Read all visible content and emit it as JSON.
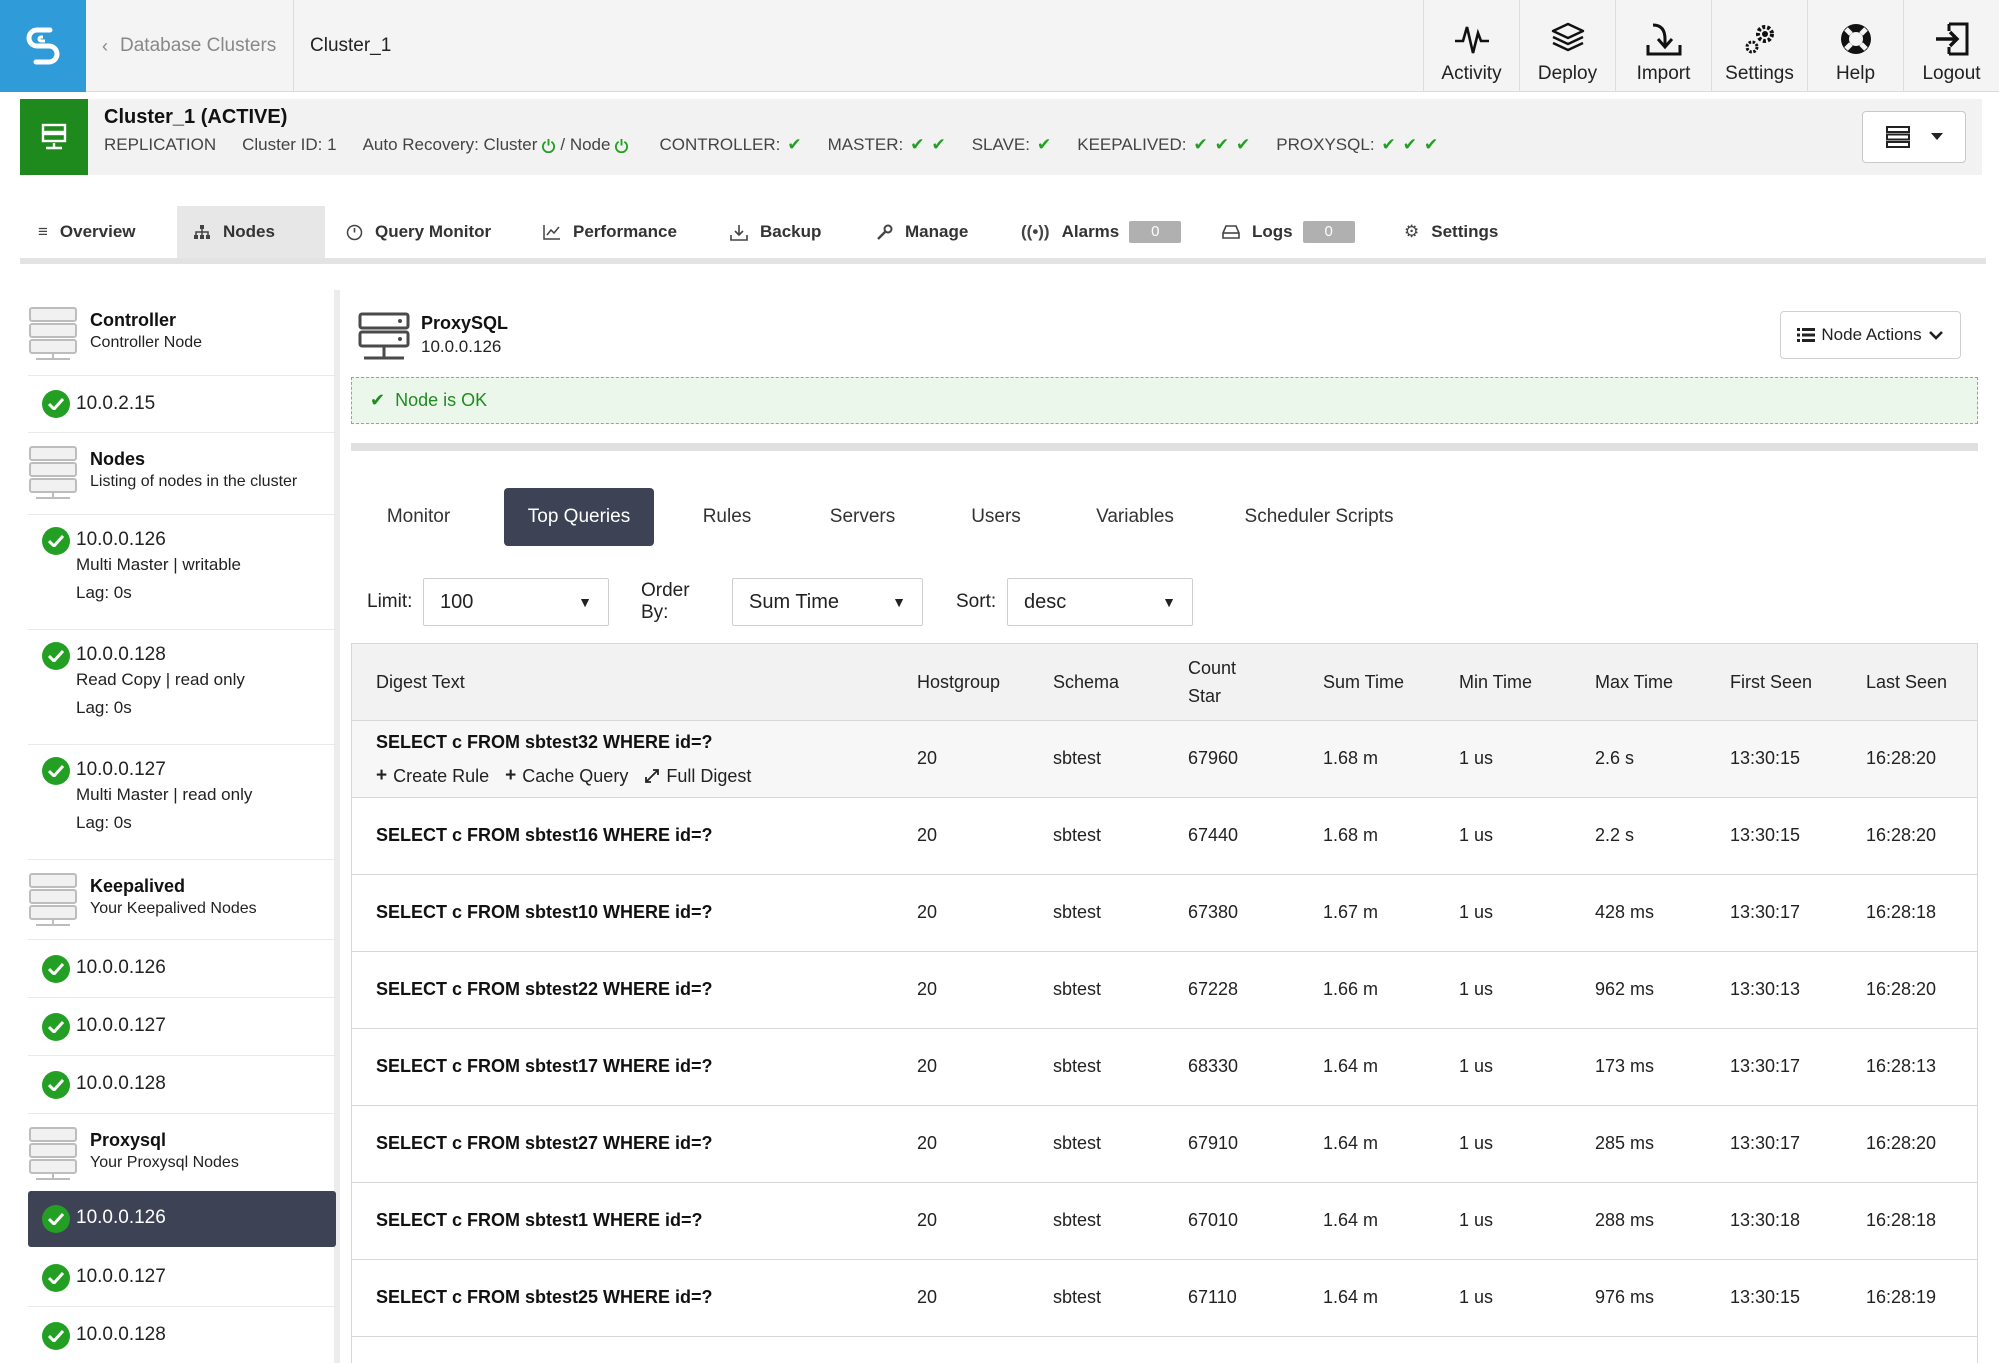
{
  "breadcrumb": {
    "back_label": "Database Clusters",
    "current": "Cluster_1"
  },
  "top_nav": [
    {
      "label": "Activity",
      "icon": "activity-icon"
    },
    {
      "label": "Deploy",
      "icon": "deploy-icon"
    },
    {
      "label": "Import",
      "icon": "import-icon"
    },
    {
      "label": "Settings",
      "icon": "settings-gears-icon"
    },
    {
      "label": "Help",
      "icon": "help-lifebuoy-icon"
    },
    {
      "label": "Logout",
      "icon": "logout-icon"
    }
  ],
  "cluster": {
    "title": "Cluster_1 (ACTIVE)",
    "type": "REPLICATION",
    "cluster_id": "Cluster ID: 1",
    "auto_recovery": "Auto Recovery: Cluster",
    "auto_recovery_node": "/ Node",
    "roles": [
      {
        "label": "CONTROLLER:",
        "checks": 1
      },
      {
        "label": "MASTER:",
        "checks": 2
      },
      {
        "label": "SLAVE:",
        "checks": 1
      },
      {
        "label": "KEEPALIVED:",
        "checks": 3
      },
      {
        "label": "PROXYSQL:",
        "checks": 3
      }
    ],
    "check_glyph": "✔"
  },
  "tabs": {
    "overview": "Overview",
    "nodes": "Nodes",
    "query_monitor": "Query Monitor",
    "performance": "Performance",
    "backup": "Backup",
    "manage": "Manage",
    "alarms": "Alarms",
    "alarms_count": "0",
    "logs": "Logs",
    "logs_count": "0",
    "settings": "Settings"
  },
  "sidebar": {
    "groups": [
      {
        "title": "Controller",
        "subtitle": "Controller Node"
      },
      {
        "title": "Nodes",
        "subtitle": "Listing of nodes in the cluster"
      },
      {
        "title": "Keepalived",
        "subtitle": "Your Keepalived Nodes"
      },
      {
        "title": "Proxysql",
        "subtitle": "Your Proxysql Nodes"
      }
    ],
    "controller_ip": "10.0.2.15",
    "db_nodes": [
      {
        "ip": "10.0.0.126",
        "role": "Multi Master | writable",
        "lag": "Lag: 0s"
      },
      {
        "ip": "10.0.0.128",
        "role": "Read Copy | read only",
        "lag": "Lag: 0s"
      },
      {
        "ip": "10.0.0.127",
        "role": "Multi Master | read only",
        "lag": "Lag: 0s"
      }
    ],
    "keepalived_ips": [
      "10.0.0.126",
      "10.0.0.127",
      "10.0.0.128"
    ],
    "proxysql_ips": [
      "10.0.0.126",
      "10.0.0.127",
      "10.0.0.128"
    ]
  },
  "node": {
    "title": "ProxySQL",
    "ip": "10.0.0.126",
    "actions_label": "Node Actions",
    "status": "Node is OK"
  },
  "subtabs": [
    "Monitor",
    "Top Queries",
    "Rules",
    "Servers",
    "Users",
    "Variables",
    "Scheduler Scripts"
  ],
  "filters": {
    "limit_label": "Limit:",
    "limit_value": "100",
    "order_label": "Order By:",
    "order_value": "Sum Time",
    "sort_label": "Sort:",
    "sort_value": "desc"
  },
  "table": {
    "headers": {
      "digest": "Digest Text",
      "hostgroup": "Hostgroup",
      "schema": "Schema",
      "count_star_1": "Count",
      "count_star_2": "Star",
      "sum_time": "Sum Time",
      "min_time": "Min Time",
      "max_time": "Max Time",
      "first_seen": "First Seen",
      "last_seen": "Last Seen"
    },
    "row_actions": {
      "create_rule": "Create Rule",
      "cache_query": "Cache Query",
      "full_digest": "Full Digest"
    },
    "rows": [
      {
        "digest": "SELECT c FROM sbtest32 WHERE id=?",
        "hostgroup": "20",
        "schema": "sbtest",
        "count_star": "67960",
        "sum_time": "1.68 m",
        "min_time": "1 us",
        "max_time": "2.6 s",
        "first_seen": "13:30:15",
        "last_seen": "16:28:20"
      },
      {
        "digest": "SELECT c FROM sbtest16 WHERE id=?",
        "hostgroup": "20",
        "schema": "sbtest",
        "count_star": "67440",
        "sum_time": "1.68 m",
        "min_time": "1 us",
        "max_time": "2.2 s",
        "first_seen": "13:30:15",
        "last_seen": "16:28:20"
      },
      {
        "digest": "SELECT c FROM sbtest10 WHERE id=?",
        "hostgroup": "20",
        "schema": "sbtest",
        "count_star": "67380",
        "sum_time": "1.67 m",
        "min_time": "1 us",
        "max_time": "428 ms",
        "first_seen": "13:30:17",
        "last_seen": "16:28:18"
      },
      {
        "digest": "SELECT c FROM sbtest22 WHERE id=?",
        "hostgroup": "20",
        "schema": "sbtest",
        "count_star": "67228",
        "sum_time": "1.66 m",
        "min_time": "1 us",
        "max_time": "962 ms",
        "first_seen": "13:30:13",
        "last_seen": "16:28:20"
      },
      {
        "digest": "SELECT c FROM sbtest17 WHERE id=?",
        "hostgroup": "20",
        "schema": "sbtest",
        "count_star": "68330",
        "sum_time": "1.64 m",
        "min_time": "1 us",
        "max_time": "173 ms",
        "first_seen": "13:30:17",
        "last_seen": "16:28:13"
      },
      {
        "digest": "SELECT c FROM sbtest27 WHERE id=?",
        "hostgroup": "20",
        "schema": "sbtest",
        "count_star": "67910",
        "sum_time": "1.64 m",
        "min_time": "1 us",
        "max_time": "285 ms",
        "first_seen": "13:30:17",
        "last_seen": "16:28:20"
      },
      {
        "digest": "SELECT c FROM sbtest1 WHERE id=?",
        "hostgroup": "20",
        "schema": "sbtest",
        "count_star": "67010",
        "sum_time": "1.64 m",
        "min_time": "1 us",
        "max_time": "288 ms",
        "first_seen": "13:30:18",
        "last_seen": "16:28:18"
      },
      {
        "digest": "SELECT c FROM sbtest25 WHERE id=?",
        "hostgroup": "20",
        "schema": "sbtest",
        "count_star": "67110",
        "sum_time": "1.64 m",
        "min_time": "1 us",
        "max_time": "976 ms",
        "first_seen": "13:30:15",
        "last_seen": "16:28:19"
      }
    ]
  },
  "colors": {
    "brand": "#2f9bd8",
    "ok_green": "#23a023",
    "cluster_green": "#1e8a1e",
    "selected": "#3d4354"
  }
}
